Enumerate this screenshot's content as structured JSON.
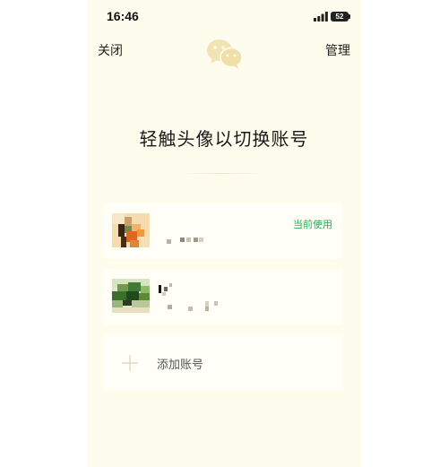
{
  "status_bar": {
    "time": "16:46",
    "battery_level": "52"
  },
  "nav": {
    "close_label": "关闭",
    "manage_label": "管理",
    "logo_icon": "wechat-logo-icon"
  },
  "page": {
    "title": "轻触头像以切换账号"
  },
  "accounts": [
    {
      "current_badge": "当前使用",
      "avatar_icon": "avatar-pixelated"
    },
    {
      "avatar_icon": "avatar-pixelated"
    }
  ],
  "add_account": {
    "label": "添加账号",
    "icon": "plus-icon"
  },
  "colors": {
    "background": "#fefcec",
    "card": "#fffff8",
    "accent_green": "#22b14c",
    "logo": "#f1e3b3"
  }
}
